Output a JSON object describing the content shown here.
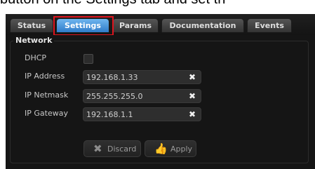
{
  "caption": "button on the Settings tab and set th",
  "tabs": [
    {
      "label": "Status"
    },
    {
      "label": "Settings",
      "active": true
    },
    {
      "label": "Params"
    },
    {
      "label": "Documentation"
    },
    {
      "label": "Events"
    }
  ],
  "network": {
    "legend": "Network",
    "dhcp": {
      "label": "DHCP",
      "checked": false
    },
    "ip_address": {
      "label": "IP Address",
      "value": "192.168.1.33"
    },
    "ip_netmask": {
      "label": "IP Netmask",
      "value": "255.255.255.0"
    },
    "ip_gateway": {
      "label": "IP Gateway",
      "value": "192.168.1.1"
    }
  },
  "buttons": {
    "discard_label": "Discard",
    "apply_label": "Apply"
  },
  "colors": {
    "active_tab": "#3f8fdc",
    "highlight": "#e0141e",
    "panel_bg": "#151515"
  },
  "icons": {
    "clear": "close-icon",
    "discard": "x-icon",
    "apply": "thumbs-up-icon"
  }
}
